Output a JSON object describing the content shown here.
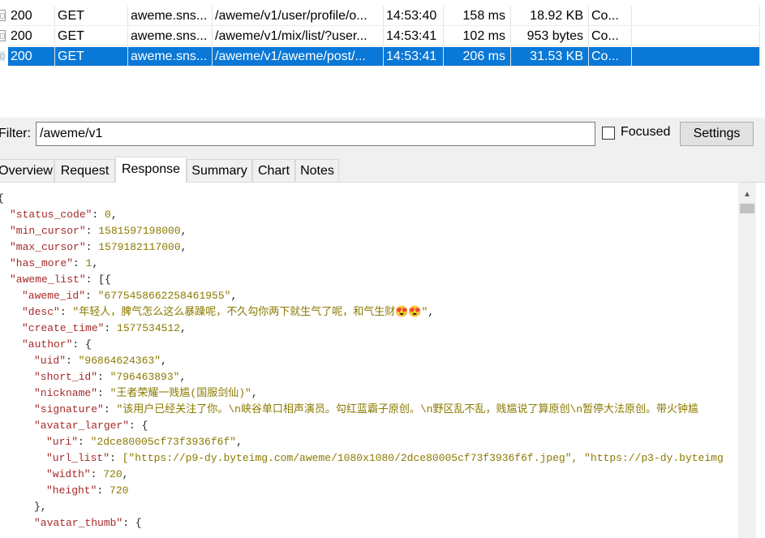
{
  "requests": [
    {
      "status": "200",
      "method": "GET",
      "host": "aweme.sns...",
      "url": "/aweme/v1/user/profile/o...",
      "time": "14:53:40",
      "duration": "158 ms",
      "size": "18.92 KB",
      "type": "Co..."
    },
    {
      "status": "200",
      "method": "GET",
      "host": "aweme.sns...",
      "url": "/aweme/v1/mix/list/?user...",
      "time": "14:53:41",
      "duration": "102 ms",
      "size": "953 bytes",
      "type": "Co..."
    },
    {
      "status": "200",
      "method": "GET",
      "host": "aweme.sns...",
      "url": "/aweme/v1/aweme/post/...",
      "time": "14:53:41",
      "duration": "206 ms",
      "size": "31.53 KB",
      "type": "Co..."
    }
  ],
  "filter": {
    "label": "Filter:",
    "value": "/aweme/v1",
    "focused_label": "Focused",
    "settings_label": "Settings"
  },
  "tabs": [
    "Overview",
    "Request",
    "Response",
    "Summary",
    "Chart",
    "Notes"
  ],
  "active_tab": "Response",
  "response_lines": [
    {
      "indent": 0,
      "key": "",
      "value": "{",
      "vtype": "p",
      "suffix": ""
    },
    {
      "indent": 1,
      "key": "\"status_code\"",
      "value": "0",
      "vtype": "n",
      "suffix": ","
    },
    {
      "indent": 1,
      "key": "\"min_cursor\"",
      "value": "1581597198000",
      "vtype": "n",
      "suffix": ","
    },
    {
      "indent": 1,
      "key": "\"max_cursor\"",
      "value": "1579182117000",
      "vtype": "n",
      "suffix": ","
    },
    {
      "indent": 1,
      "key": "\"has_more\"",
      "value": "1",
      "vtype": "n",
      "suffix": ","
    },
    {
      "indent": 1,
      "key": "\"aweme_list\"",
      "value": "[{",
      "vtype": "p",
      "suffix": ""
    },
    {
      "indent": 2,
      "key": "\"aweme_id\"",
      "value": "\"6775458662258461955\"",
      "vtype": "s",
      "suffix": ","
    },
    {
      "indent": 2,
      "key": "\"desc\"",
      "value": "\"年轻人，脾气怎么这么暴躁呢，不久勾你两下就生气了呢，和气生财😍😍\"",
      "vtype": "s",
      "suffix": ","
    },
    {
      "indent": 2,
      "key": "\"create_time\"",
      "value": "1577534512",
      "vtype": "n",
      "suffix": ","
    },
    {
      "indent": 2,
      "key": "\"author\"",
      "value": "{",
      "vtype": "p",
      "suffix": ""
    },
    {
      "indent": 3,
      "key": "\"uid\"",
      "value": "\"96864624363\"",
      "vtype": "s",
      "suffix": ","
    },
    {
      "indent": 3,
      "key": "\"short_id\"",
      "value": "\"796463893\"",
      "vtype": "s",
      "suffix": ","
    },
    {
      "indent": 3,
      "key": "\"nickname\"",
      "value": "\"王者荣耀一贱尴(国服剑仙)\"",
      "vtype": "s",
      "suffix": ","
    },
    {
      "indent": 3,
      "key": "\"signature\"",
      "value": "\"该用户已经关注了你。\\n峡谷单口相声演员。勾红蓝霸子原创。\\n野区乱不乱，贱尴说了算原创\\n暂停大法原创。带火钟尴",
      "vtype": "s",
      "suffix": ""
    },
    {
      "indent": 3,
      "key": "\"avatar_larger\"",
      "value": "{",
      "vtype": "p",
      "suffix": ""
    },
    {
      "indent": 4,
      "key": "\"uri\"",
      "value": "\"2dce80005cf73f3936f6f\"",
      "vtype": "s",
      "suffix": ","
    },
    {
      "indent": 4,
      "key": "\"url_list\"",
      "value": "[\"https://p9-dy.byteimg.com/aweme/1080x1080/2dce80005cf73f3936f6f.jpeg\", \"https://p3-dy.byteimg",
      "vtype": "s",
      "suffix": ""
    },
    {
      "indent": 4,
      "key": "\"width\"",
      "value": "720",
      "vtype": "n",
      "suffix": ","
    },
    {
      "indent": 4,
      "key": "\"height\"",
      "value": "720",
      "vtype": "n",
      "suffix": ""
    },
    {
      "indent": 3,
      "key": "",
      "value": "},",
      "vtype": "p",
      "suffix": ""
    },
    {
      "indent": 3,
      "key": "\"avatar_thumb\"",
      "value": "{",
      "vtype": "p",
      "suffix": ""
    }
  ]
}
